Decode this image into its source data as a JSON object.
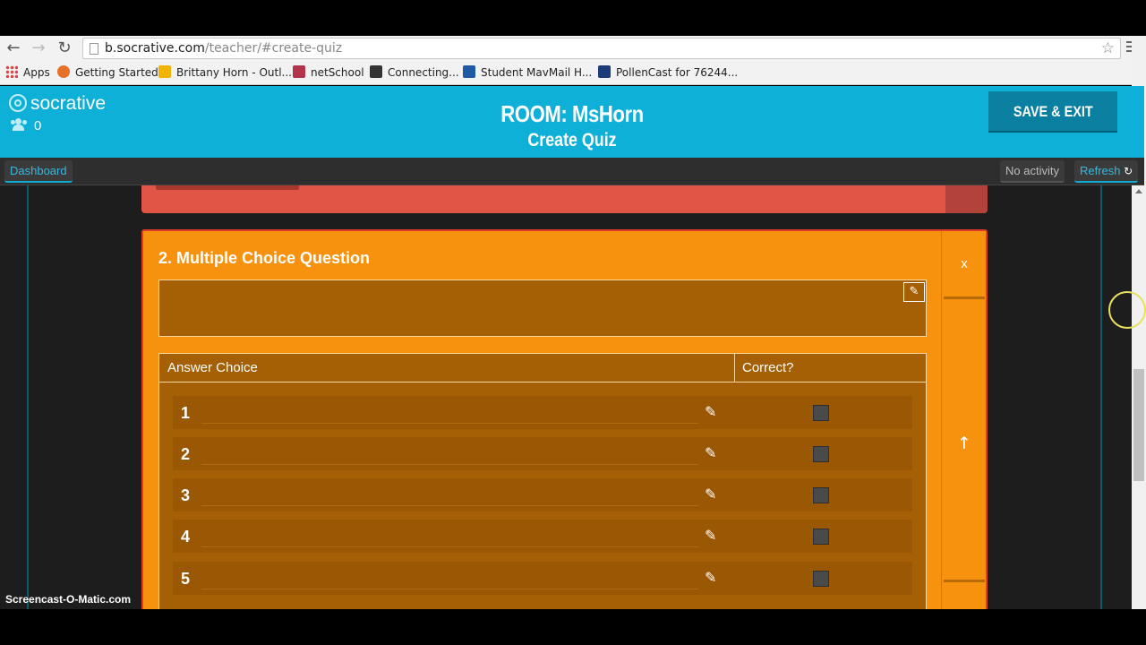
{
  "browser": {
    "url_host": "b.socrative.com",
    "url_path": "/teacher/#create-quiz",
    "bookmarks": [
      {
        "label": "Apps",
        "color": "#d44"
      },
      {
        "label": "Getting Started",
        "color": "#e8712a"
      },
      {
        "label": "Brittany Horn - Outl...",
        "color": "#f2b200"
      },
      {
        "label": "netSchool",
        "color": "#b2344a"
      },
      {
        "label": "Connecting...",
        "color": "#333333"
      },
      {
        "label": "Student MavMail H...",
        "color": "#1f5aa6"
      },
      {
        "label": "PollenCast for 76244...",
        "color": "#1c3b7a"
      }
    ]
  },
  "header": {
    "logo": "socrative",
    "user_count": "0",
    "room_title": "ROOM: MsHorn",
    "subtitle": "Create Quiz",
    "save_exit": "SAVE & EXIT",
    "accent_color": "#0fb0d8"
  },
  "subbar": {
    "dashboard": "Dashboard",
    "no_activity": "No activity",
    "refresh": "Refresh"
  },
  "question": {
    "title": "2. Multiple Choice Question",
    "close": "x",
    "move_up": "↑",
    "col_answer": "Answer Choice",
    "col_correct": "Correct?",
    "choices": [
      "1",
      "2",
      "3",
      "4",
      "5"
    ]
  },
  "watermark": "Screencast-O-Matic.com"
}
